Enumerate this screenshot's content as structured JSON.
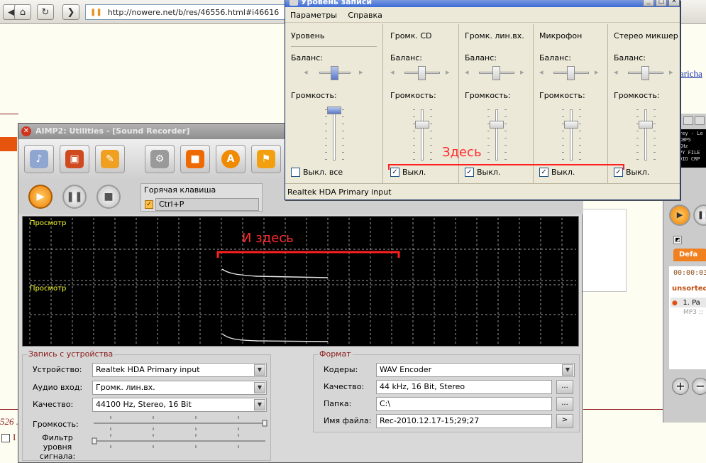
{
  "browser": {
    "url": "http://nowere.net/b/res/46556.html#i46616",
    "back_icon": "back-arrow",
    "home_icon": "home",
    "reload_icon": "reload",
    "forward_icon": "forward-arrow"
  },
  "page": {
    "right_link": "aricha",
    "bottom_text": "526 ."
  },
  "aimp_utilities": {
    "title": "AIMP2: Utilities - [Sound Recorder]",
    "hotkey_label": "Горячая клавиша",
    "hotkey_value": "Ctrl+P",
    "preview_label_1": "Просмотр",
    "preview_label_2": "Просмотр",
    "annotation": "И здесь",
    "device_group": {
      "title": "Запись с устройства",
      "device_label": "Устройство:",
      "device_value": "Realtek HDA Primary input",
      "input_label": "Аудио вход:",
      "input_value": "Громк. лин.вх.",
      "quality_label": "Качество:",
      "quality_value": "44100 Hz, Stereo, 16 Bit",
      "volume_label": "Громкость:",
      "volume_level": 1.0,
      "filter_label": "Фильтр уровня сигнала:",
      "filter_level": 0.0
    },
    "format_group": {
      "title": "Формат",
      "encoder_label": "Кодеры:",
      "encoder_value": "WAV Encoder",
      "quality_label": "Качество:",
      "quality_value": "44 kHz, 16 Bit, Stereo",
      "folder_label": "Папка:",
      "folder_value": "C:\\",
      "filename_label": "Имя файла:",
      "filename_value": "Rec-2010.12.17-15;29;27",
      "browse_label": "...",
      "arrow_label": ">"
    }
  },
  "recording_dialog": {
    "title": "Уровень записи",
    "menu": [
      "Параметры",
      "Справка"
    ],
    "annotation": "Здесь",
    "status": "Realtek HDA Primary input",
    "balance_label": "Баланс:",
    "volume_label": "Громкость:",
    "columns": [
      {
        "name": "Уровень",
        "mute_label": "Выкл. все",
        "muted": false,
        "volume": 1.0
      },
      {
        "name": "Громк. CD",
        "mute_label": "Выкл.",
        "muted": true,
        "volume": 0.7
      },
      {
        "name": "Громк. лин.вх.",
        "mute_label": "Выкл.",
        "muted": true,
        "volume": 0.7
      },
      {
        "name": "Микрофон",
        "mute_label": "Выкл.",
        "muted": true,
        "volume": 0.7
      },
      {
        "name": "Стерео микшер",
        "mute_label": "Выкл.",
        "muted": true,
        "volume": 0.7
      }
    ]
  },
  "player": {
    "screen_text": "rey - Le\nKBPS\nKHz\nPY FILE\nDIO CRP",
    "time": "00:00:03",
    "tab": "Defa",
    "playlist_title": "unsorted",
    "track": "1. Pa",
    "track_info": "MP3 ::"
  }
}
